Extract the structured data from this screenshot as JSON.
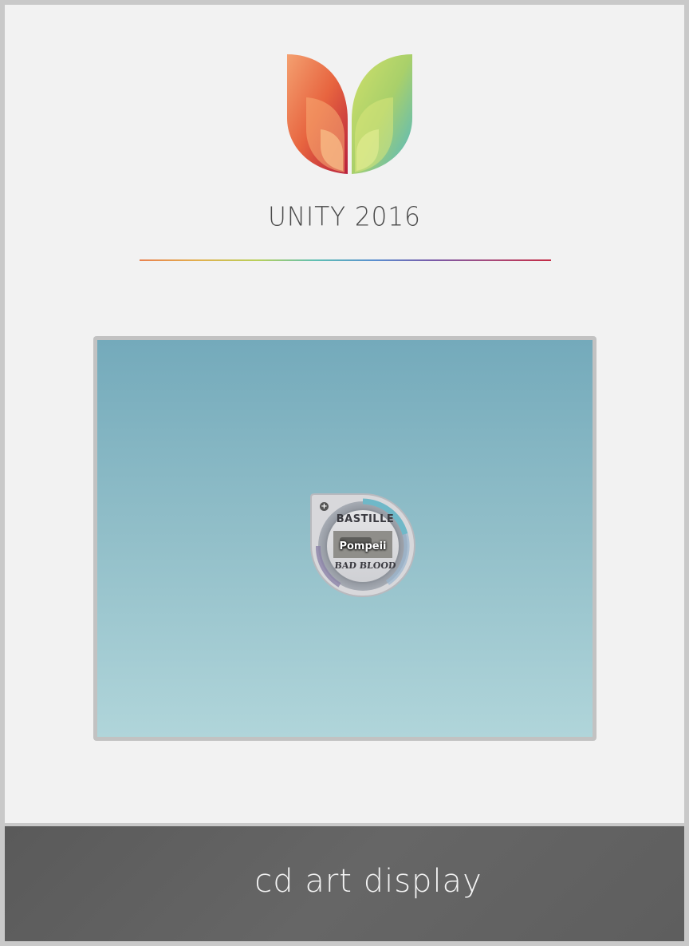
{
  "header": {
    "title": "UNITY 2016"
  },
  "colors": {
    "leaf_left": "#e9824f",
    "leaf_right": "#b9d05a",
    "screen_top": "#74aabb",
    "screen_bottom": "#b0d5da",
    "footer": "#5e5e5e"
  },
  "widget": {
    "album_artist": "BASTILLE",
    "album_title": "BAD BLOOD",
    "track_title": "Pompeii",
    "icon": "plus-icon"
  },
  "footer": {
    "label": "cd art display"
  }
}
